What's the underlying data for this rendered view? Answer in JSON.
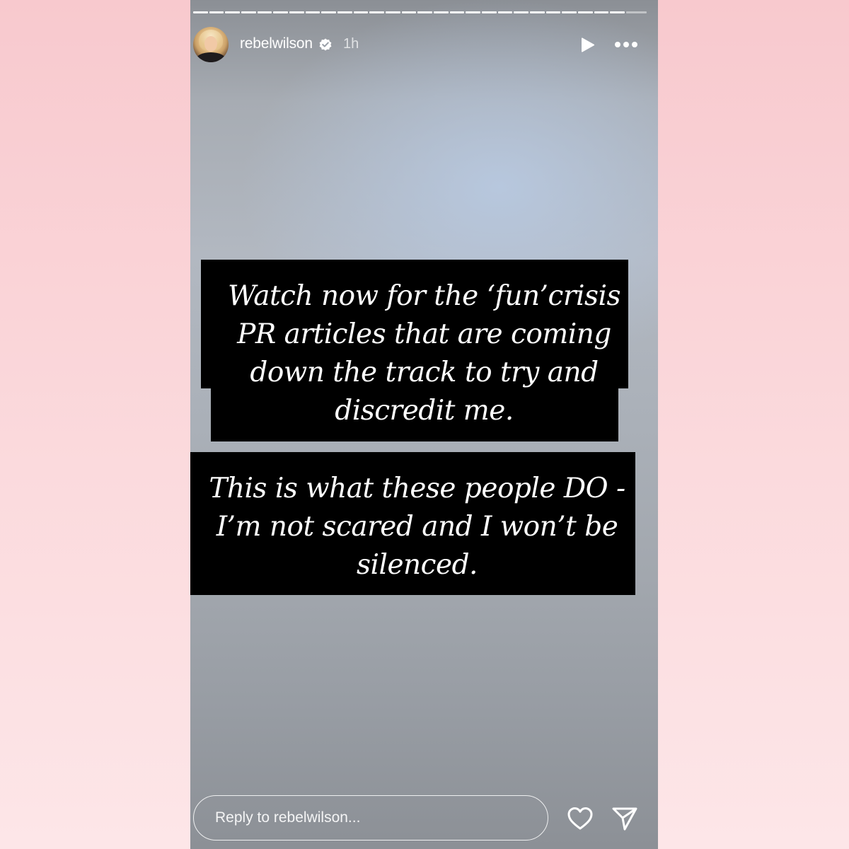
{
  "story": {
    "progress_segments": 28,
    "header": {
      "username": "rebelwilson",
      "verified": true,
      "verified_icon": "verified-badge-icon",
      "time": "1h",
      "play_icon": "play-icon",
      "more_icon": "more-options-icon"
    },
    "caption_1": {
      "lines": [
        "Watch now for the ‘fun’crisis",
        "PR articles that are coming",
        "down the track to try and",
        "discredit me."
      ]
    },
    "caption_2": {
      "lines": [
        "This is what these people DO -",
        "I’m not scared and I won’t be",
        "silenced."
      ]
    },
    "footer": {
      "reply_placeholder": "Reply to rebelwilson...",
      "like_icon": "heart-icon",
      "share_icon": "send-icon"
    }
  },
  "colors": {
    "caption_background": "#000000",
    "caption_text": "#ffffff",
    "page_background_top": "#f8c9ce",
    "page_background_bottom": "#fde6e8"
  }
}
